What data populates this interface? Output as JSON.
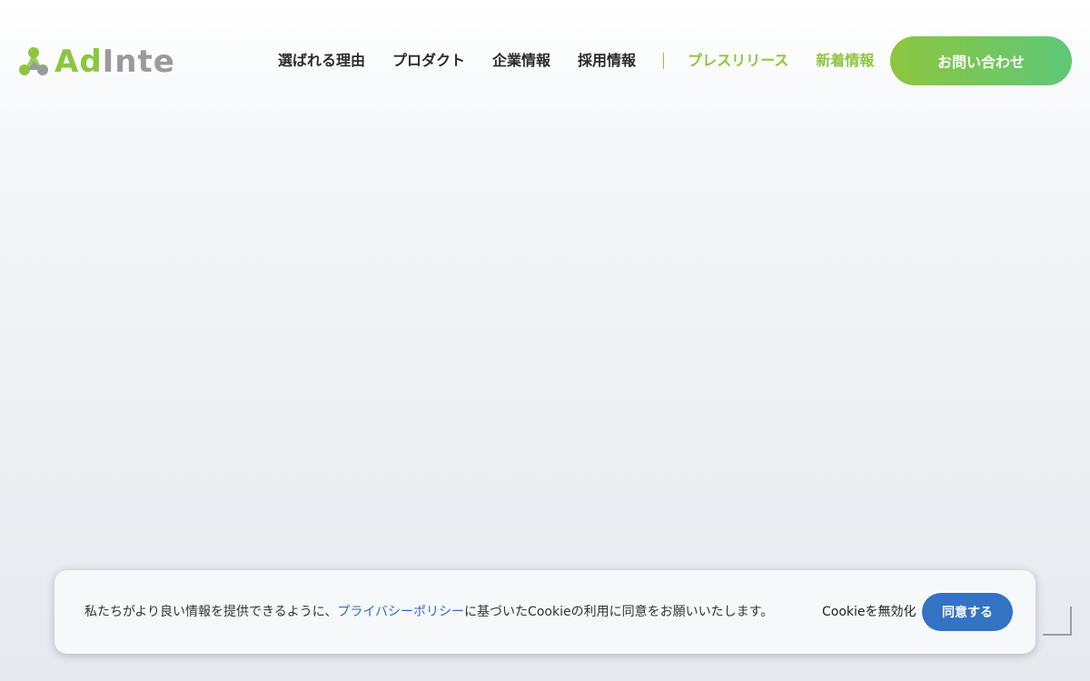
{
  "header": {
    "logo": {
      "text_part1": "Ad",
      "text_part2": "Inte",
      "mark_icon": "tri-dot-logo-icon",
      "colors": {
        "green": "#8cc63f",
        "gray": "#9a9a9a"
      }
    },
    "nav": {
      "items": [
        {
          "label": "選ばれる理由"
        },
        {
          "label": "プロダクト"
        },
        {
          "label": "企業情報"
        },
        {
          "label": "採用情報"
        },
        {
          "label": "プレスリリース"
        },
        {
          "label": "新着情報"
        }
      ]
    },
    "contact_button": {
      "label": "お問い合わせ"
    }
  },
  "cookie_banner": {
    "text_before": "私たちがより良い情報を提供できるように、",
    "link_label": "プライバシーポリシー",
    "text_after": "に基づいたCookieの利用に同意をお願いいたします。",
    "decline_label": "Cookieを無効化",
    "accept_label": "同意する"
  },
  "colors": {
    "accent_green": "#8cc63f",
    "accept_blue": "#3273c4",
    "link_blue": "#2f6ebd"
  }
}
